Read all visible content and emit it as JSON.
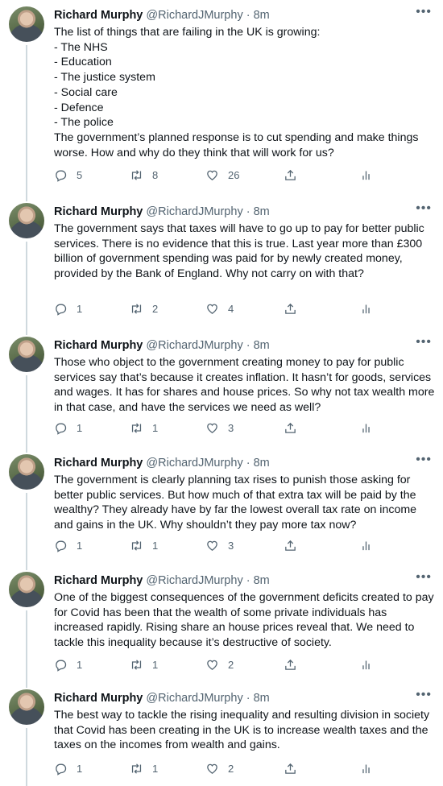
{
  "tweets": [
    {
      "name": "Richard Murphy",
      "handle": "@RichardJMurphy",
      "time": "8m",
      "text": "The list of things that are failing in the UK is growing:\n- The NHS\n- Education\n- The justice system\n- Social care\n- Defence\n- The police\nThe government’s planned response is to cut spending and make things worse. How and why do they think that will work for us?",
      "replies": "5",
      "retweets": "8",
      "likes": "26"
    },
    {
      "name": "Richard Murphy",
      "handle": "@RichardJMurphy",
      "time": "8m",
      "text": "The government says that taxes will have to go up to pay for better public services. There is no evidence that this is true. Last year more than £300 billion of government spending was paid for by newly created money, provided by the Bank of England. Why not carry on with that?",
      "replies": "1",
      "retweets": "2",
      "likes": "4"
    },
    {
      "name": "Richard Murphy",
      "handle": "@RichardJMurphy",
      "time": "8m",
      "text": "Those who object to the government creating money to pay for public services say that’s because it creates inflation. It hasn’t for goods, services and wages. It has for shares and house prices. So why not tax wealth more in that case, and have the services we need as well?",
      "replies": "1",
      "retweets": "1",
      "likes": "3"
    },
    {
      "name": "Richard Murphy",
      "handle": "@RichardJMurphy",
      "time": "8m",
      "text": "The government is clearly  planning tax rises to punish those asking for better public services. But how much of that extra tax will be paid by the wealthy? They already have by far the lowest overall tax rate on income and gains in the UK. Why shouldn’t they pay more tax now?",
      "replies": "1",
      "retweets": "1",
      "likes": "3"
    },
    {
      "name": "Richard Murphy",
      "handle": "@RichardJMurphy",
      "time": "8m",
      "text": "One of the biggest consequences of the government deficits created to pay for Covid has been that the wealth of some private individuals has increased rapidly. Rising share an house prices reveal that. We need to tackle this inequality because it’s destructive of society.",
      "replies": "1",
      "retweets": "1",
      "likes": "2"
    },
    {
      "name": "Richard Murphy",
      "handle": "@RichardJMurphy",
      "time": "8m",
      "text": "The best way to tackle the rising inequality and resulting division in society that Covid has been creating in the UK is to increase wealth taxes and the taxes on the incomes from wealth and gains.",
      "replies": "1",
      "retweets": "1",
      "likes": "2"
    }
  ],
  "icons": {
    "reply": "reply-icon",
    "retweet": "retweet-icon",
    "like": "heart-icon",
    "share": "share-icon",
    "analytics": "analytics-icon",
    "more": "more-icon"
  },
  "colors": {
    "text": "#0f1419",
    "secondary": "#536471",
    "thread_line": "#cfd9de"
  }
}
